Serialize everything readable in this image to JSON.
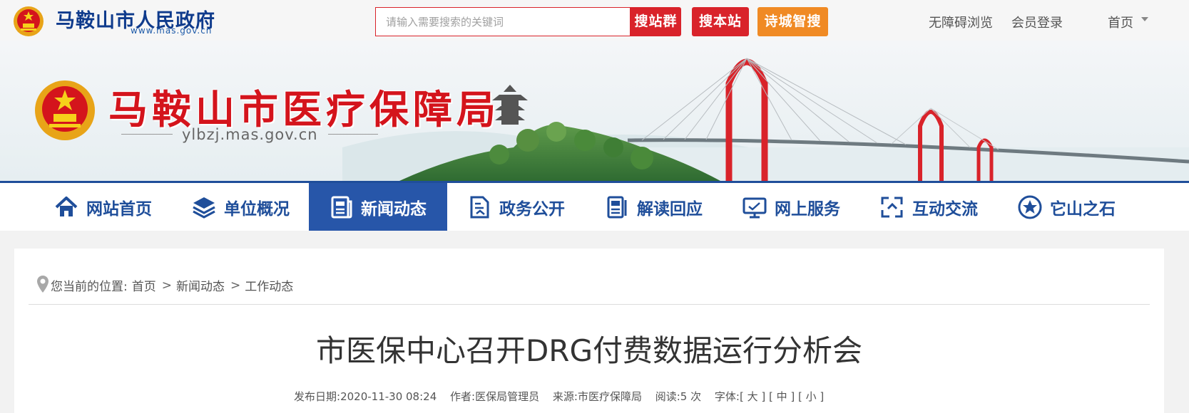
{
  "topbar": {
    "gov_name": "马鞍山市人民政府",
    "gov_url": "www.mas.gov.cn",
    "search_placeholder": "请输入需要搜索的关键词",
    "btn_group": "搜站群",
    "btn_site": "搜本站",
    "btn_smart": "诗城智搜",
    "link_access": "无障碍浏览",
    "link_login": "会员登录",
    "link_home": "首页"
  },
  "banner": {
    "title": "马鞍山市医疗保障局",
    "url": "ylbzj.mas.gov.cn"
  },
  "nav": {
    "items": [
      {
        "label": "网站首页",
        "icon": "home-icon"
      },
      {
        "label": "单位概况",
        "icon": "layers-icon"
      },
      {
        "label": "新闻动态",
        "icon": "newspaper-icon",
        "active": true
      },
      {
        "label": "政务公开",
        "icon": "document-icon"
      },
      {
        "label": "解读回应",
        "icon": "reader-icon"
      },
      {
        "label": "网上服务",
        "icon": "monitor-icon"
      },
      {
        "label": "互动交流",
        "icon": "interaction-icon"
      },
      {
        "label": "它山之石",
        "icon": "star-icon"
      }
    ]
  },
  "breadcrumb": {
    "prefix": "您当前的位置:",
    "items": [
      "首页",
      "新闻动态",
      "工作动态"
    ],
    "separator": ">"
  },
  "article": {
    "title": "市医保中心召开DRG付费数据运行分析会",
    "publish_label": "发布日期:",
    "publish_value": "2020-11-30 08:24",
    "author_label": "作者:",
    "author_value": "医保局管理员",
    "source_label": "来源:",
    "source_value": "市医疗保障局",
    "reads_label": "阅读:",
    "reads_value": "5 次",
    "font_label": "字体:",
    "font_large": "[ 大 ]",
    "font_medium": "[ 中 ]",
    "font_small": "[ 小 ]"
  },
  "colors": {
    "brand_blue": "#1f4e9a",
    "nav_active": "#2756a9",
    "accent_red": "#d9232a",
    "accent_orange": "#f08a24"
  }
}
